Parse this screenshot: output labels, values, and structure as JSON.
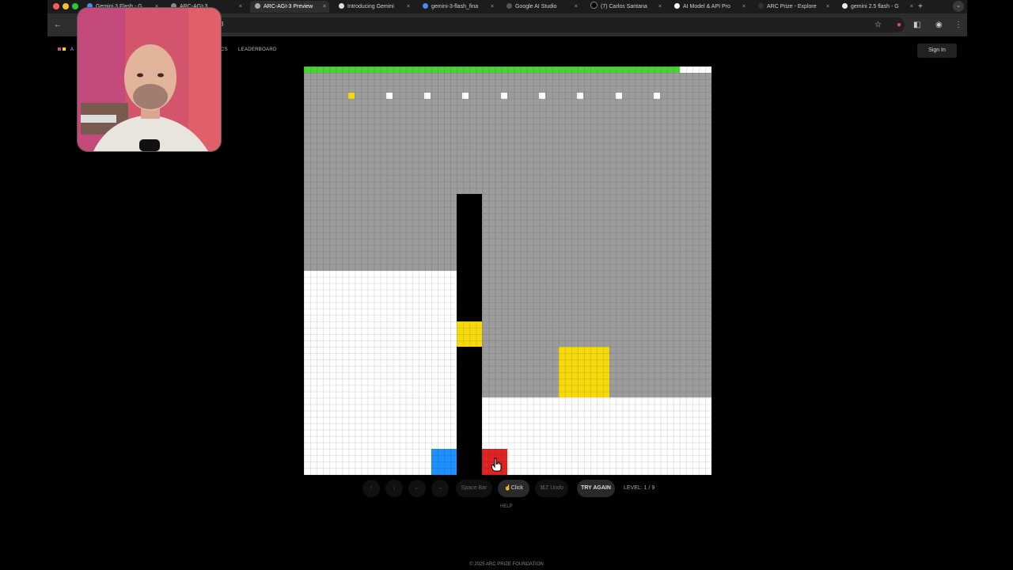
{
  "browser": {
    "tabs": [
      {
        "label": "Gemini 3 Flash - G"
      },
      {
        "label": "ARC-AGI-3"
      },
      {
        "label": "ARC-AGI-3 Preview"
      },
      {
        "label": "Introducing Gemini"
      },
      {
        "label": "gemini-3-flash_fina"
      },
      {
        "label": "Google AI Studio"
      },
      {
        "label": "(7) Carlos Santana"
      },
      {
        "label": "AI Model & API Pro"
      },
      {
        "label": "ARC Prize - Explore"
      },
      {
        "label": "gemini 2.5 flash - G"
      }
    ],
    "new_tab": "+",
    "address": "3"
  },
  "site": {
    "nav": [
      "A",
      "ICS",
      "LEADERBOARD"
    ],
    "sign_in": "Sign In"
  },
  "game": {
    "progress": 0.92,
    "colors": {
      "gray": "#9c9c9c",
      "white": "#ffffff",
      "black": "#000000",
      "yellow": "#f5d90a",
      "blue": "#1e90ff",
      "red": "#e02424",
      "green": "#4cd137"
    }
  },
  "controls": {
    "up": "↑",
    "down": "↓",
    "left": "←",
    "right": "→",
    "space": "Space Bar",
    "click": "Click",
    "undo": "⌘Z Undo",
    "try_again": "TRY AGAIN",
    "level": "LEVEL: 1 / 9"
  },
  "help": "HELP",
  "footer": "© 2025 ARC PRIZE FOUNDATION"
}
